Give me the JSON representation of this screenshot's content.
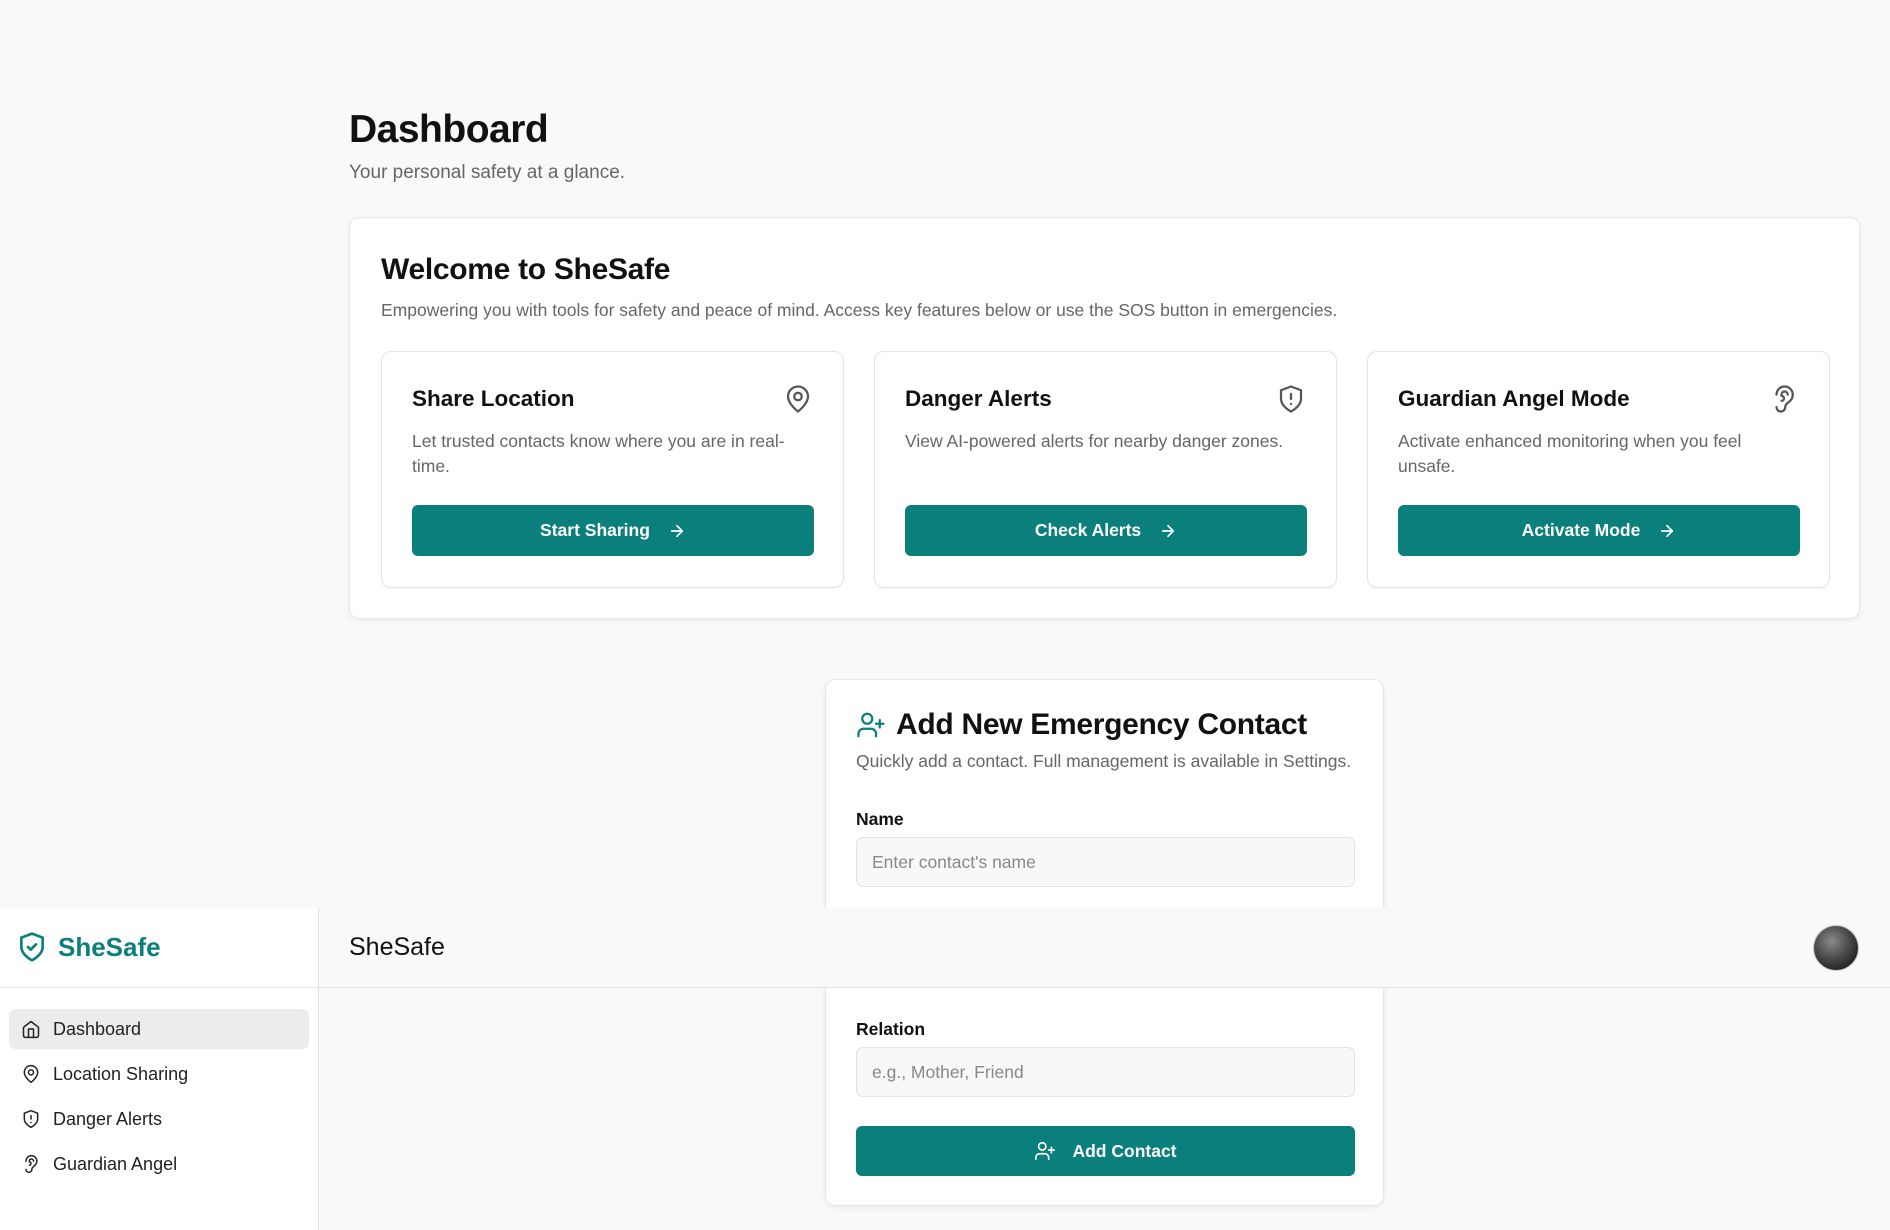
{
  "app": {
    "brand_name": "SheSafe",
    "header_title": "SheSafe"
  },
  "colors": {
    "accent": "#0b7f7c",
    "background": "#f9f9f9",
    "muted_text": "#666666"
  },
  "page": {
    "title": "Dashboard",
    "subtitle": "Your personal safety at a glance."
  },
  "welcome": {
    "title": "Welcome to SheSafe",
    "description": "Empowering you with tools for safety and peace of mind. Access key features below or use the SOS button in emergencies.",
    "features": [
      {
        "title": "Share Location",
        "icon": "map-pin-icon",
        "description": "Let trusted contacts know where you are in real-time.",
        "button": "Start Sharing"
      },
      {
        "title": "Danger Alerts",
        "icon": "shield-alert-icon",
        "description": "View AI-powered alerts for nearby danger zones.",
        "button": "Check Alerts"
      },
      {
        "title": "Guardian Angel Mode",
        "icon": "ear-icon",
        "description": "Activate enhanced monitoring when you feel unsafe.",
        "button": "Activate Mode"
      }
    ]
  },
  "contact_form": {
    "title": "Add New Emergency Contact",
    "description": "Quickly add a contact. Full management is available in Settings.",
    "name_label": "Name",
    "name_placeholder": "Enter contact's name",
    "relation_label": "Relation",
    "relation_placeholder": "e.g., Mother, Friend",
    "submit_label": "Add Contact"
  },
  "sidebar": {
    "items": [
      {
        "label": "Dashboard",
        "icon": "home-icon",
        "active": true
      },
      {
        "label": "Location Sharing",
        "icon": "map-pin-icon",
        "active": false
      },
      {
        "label": "Danger Alerts",
        "icon": "shield-alert-icon",
        "active": false
      },
      {
        "label": "Guardian Angel",
        "icon": "ear-icon",
        "active": false
      }
    ]
  }
}
